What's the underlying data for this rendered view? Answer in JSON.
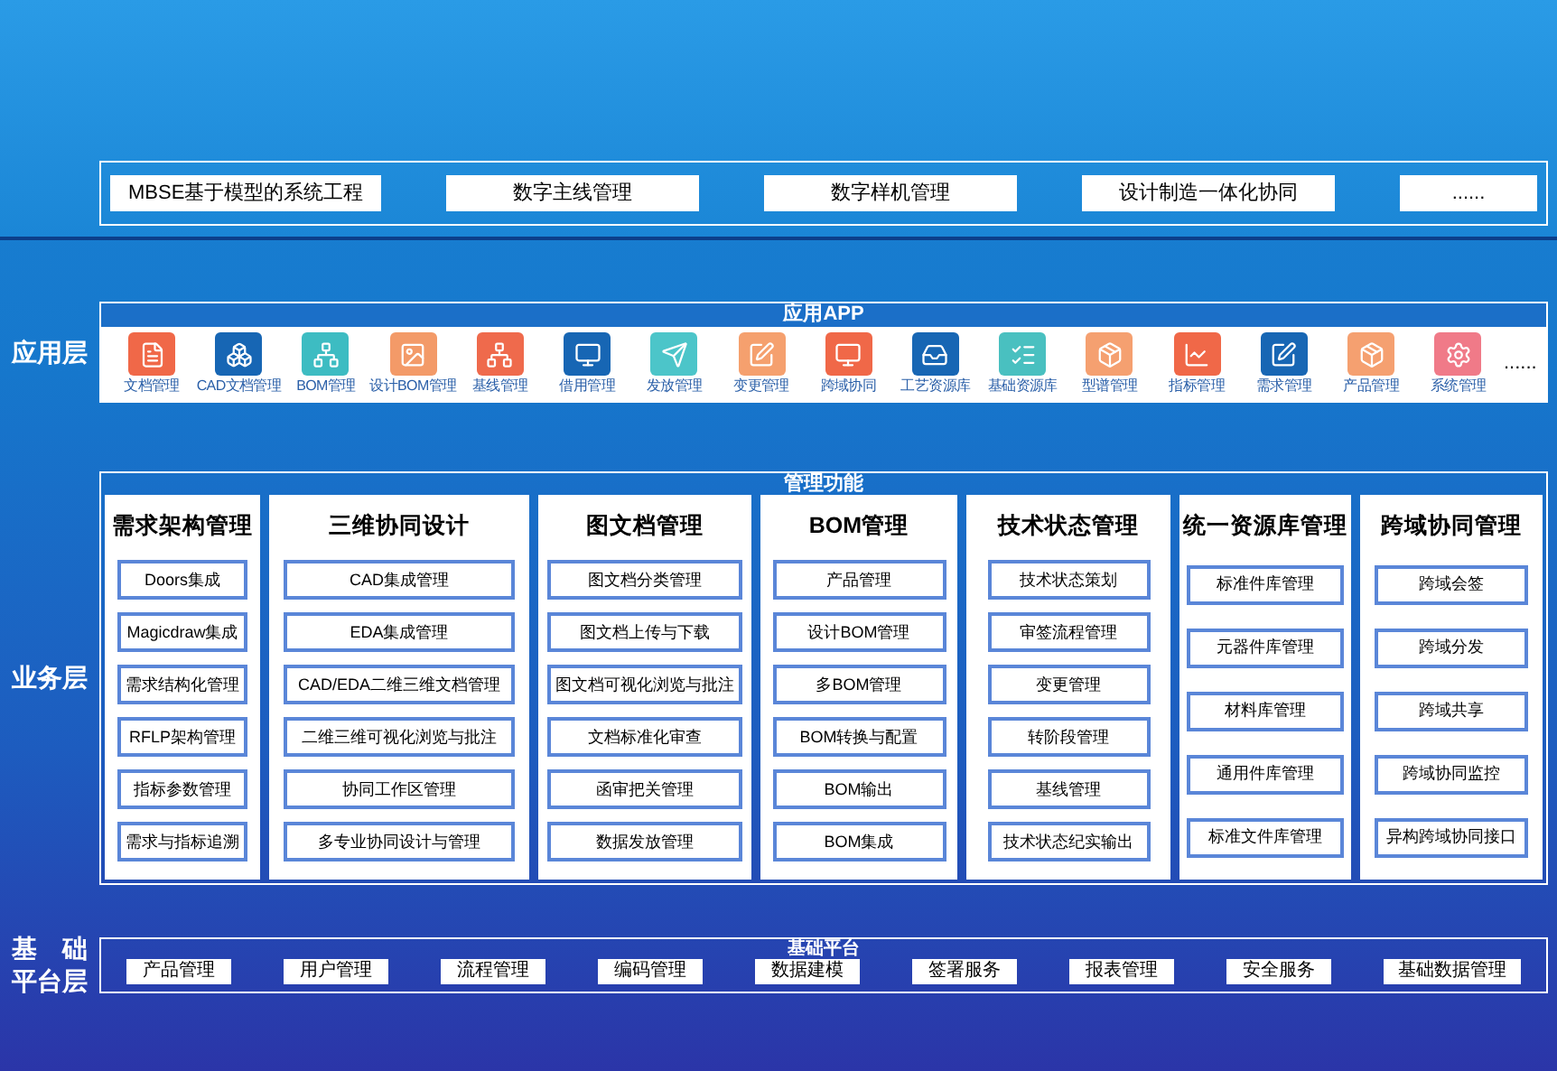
{
  "top_items": [
    "MBSE基于模型的系统工程",
    "数字主线管理",
    "数字样机管理",
    "设计制造一体化协同",
    "......"
  ],
  "app_layer": {
    "label": "应用层",
    "title": "应用APP",
    "more": "......",
    "apps": [
      {
        "name": "文档管理",
        "color": "#f06848"
      },
      {
        "name": "CAD文档管理",
        "color": "#1766b4"
      },
      {
        "name": "BOM管理",
        "color": "#3dbcc2"
      },
      {
        "name": "设计BOM管理",
        "color": "#f39a68"
      },
      {
        "name": "基线管理",
        "color": "#ef6a4c"
      },
      {
        "name": "借用管理",
        "color": "#1766b4"
      },
      {
        "name": "发放管理",
        "color": "#4cc5c9"
      },
      {
        "name": "变更管理",
        "color": "#f5a06e"
      },
      {
        "name": "跨域协同",
        "color": "#f06848"
      },
      {
        "name": "工艺资源库",
        "color": "#1766b4"
      },
      {
        "name": "基础资源库",
        "color": "#49c0c0"
      },
      {
        "name": "型谱管理",
        "color": "#f5a070"
      },
      {
        "name": "指标管理",
        "color": "#f06848"
      },
      {
        "name": "需求管理",
        "color": "#1766b4"
      },
      {
        "name": "产品管理",
        "color": "#f5a070"
      },
      {
        "name": "系统管理",
        "color": "#f07a88"
      }
    ]
  },
  "business_layer": {
    "label": "业务层",
    "title": "管理功能",
    "columns": [
      {
        "title": "需求架构管理",
        "items": [
          "Doors集成",
          "Magicdraw集成",
          "需求结构化管理",
          "RFLP架构管理",
          "指标参数管理",
          "需求与指标追溯"
        ]
      },
      {
        "title": "三维协同设计",
        "items": [
          "CAD集成管理",
          "EDA集成管理",
          "CAD/EDA二维三维文档管理",
          "二维三维可视化浏览与批注",
          "协同工作区管理",
          "多专业协同设计与管理"
        ]
      },
      {
        "title": "图文档管理",
        "items": [
          "图文档分类管理",
          "图文档上传与下载",
          "图文档可视化浏览与批注",
          "文档标准化审查",
          "函审把关管理",
          "数据发放管理"
        ]
      },
      {
        "title": "BOM管理",
        "items": [
          "产品管理",
          "设计BOM管理",
          "多BOM管理",
          "BOM转换与配置",
          "BOM输出",
          "BOM集成"
        ]
      },
      {
        "title": "技术状态管理",
        "items": [
          "技术状态策划",
          "审签流程管理",
          "变更管理",
          "转阶段管理",
          "基线管理",
          "技术状态纪实输出"
        ]
      },
      {
        "title": "统一资源库管理",
        "items": [
          "标准件库管理",
          "元器件库管理",
          "材料库管理",
          "通用件库管理",
          "标准文件库管理"
        ]
      },
      {
        "title": "跨域协同管理",
        "items": [
          "跨域会签",
          "跨域分发",
          "跨域共享",
          "跨域协同监控",
          "异构跨域协同接口"
        ]
      }
    ]
  },
  "platform_layer": {
    "label_lines": [
      "基　础",
      "平台层"
    ],
    "title": "基础平台",
    "items": [
      "产品管理",
      "用户管理",
      "流程管理",
      "编码管理",
      "数据建模",
      "签署服务",
      "报表管理",
      "安全服务",
      "基础数据管理"
    ]
  }
}
